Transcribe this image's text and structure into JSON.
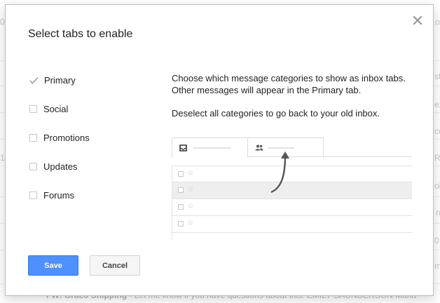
{
  "background": {
    "fragments": [
      {
        "text": "o"
      },
      {
        "text": "st"
      },
      {
        "text": "ez"
      },
      {
        "text": "cc"
      },
      {
        "text": "R"
      },
      {
        "text": "ol"
      },
      {
        "text": "n"
      },
      {
        "text": "0"
      },
      {
        "text": "ma"
      },
      {
        "text": "0"
      },
      {
        "text": "1)"
      }
    ],
    "bottom_subject": "FW: Graco Shipping",
    "bottom_snippet": " - Let me know if you have questions about this. EMILY SAUNDERSON Mana"
  },
  "dialog": {
    "title": "Select tabs to enable",
    "close_icon": "close-icon",
    "options": [
      {
        "label": "Primary",
        "checked": true,
        "locked": true
      },
      {
        "label": "Social",
        "checked": false
      },
      {
        "label": "Promotions",
        "checked": false
      },
      {
        "label": "Updates",
        "checked": false
      },
      {
        "label": "Forums",
        "checked": false
      }
    ],
    "description": {
      "line1": "Choose which message categories to show as inbox tabs.",
      "line2": "Other messages will appear in the Primary tab.",
      "line3": "Deselect all categories to go back to your old inbox."
    },
    "illustration": {
      "tab_icons": [
        "inbox-icon",
        "people-icon"
      ],
      "row_icons": [
        "checkbox-icon",
        "star-icon"
      ],
      "star_glyph": "☆"
    },
    "buttons": {
      "save_label": "Save",
      "cancel_label": "Cancel"
    },
    "colors": {
      "save_bg": "#4d90fe",
      "cancel_bg": "#f5f5f5",
      "text": "#222222"
    }
  }
}
